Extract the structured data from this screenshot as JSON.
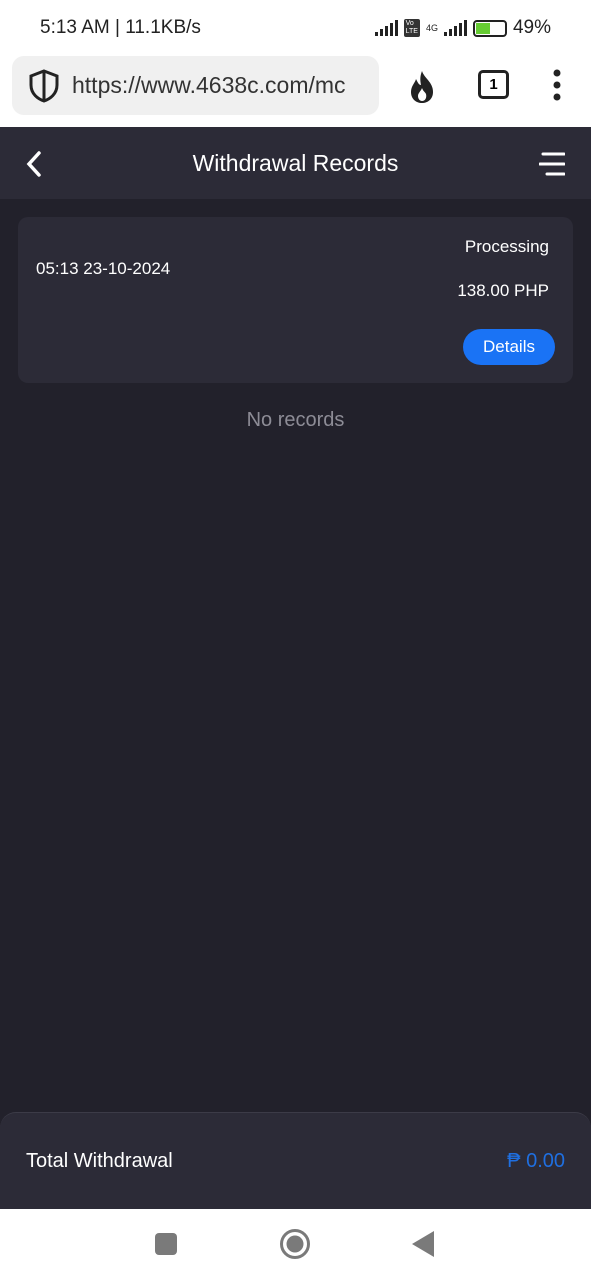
{
  "status_bar": {
    "time_speed": "5:13 AM | 11.1KB/s",
    "network": "4G",
    "battery": "49%"
  },
  "browser": {
    "url": "https://www.4638c.com/mc",
    "tab_count": "1"
  },
  "header": {
    "title": "Withdrawal Records"
  },
  "records": [
    {
      "datetime": "05:13 23-10-2024",
      "status": "Processing",
      "amount": "138.00 PHP",
      "details_label": "Details"
    }
  ],
  "empty_text": "No records",
  "footer": {
    "label": "Total Withdrawal",
    "value": "₱ 0.00"
  },
  "colors": {
    "accent": "#1a73f5",
    "background": "#22212b",
    "card": "#2c2b37"
  }
}
